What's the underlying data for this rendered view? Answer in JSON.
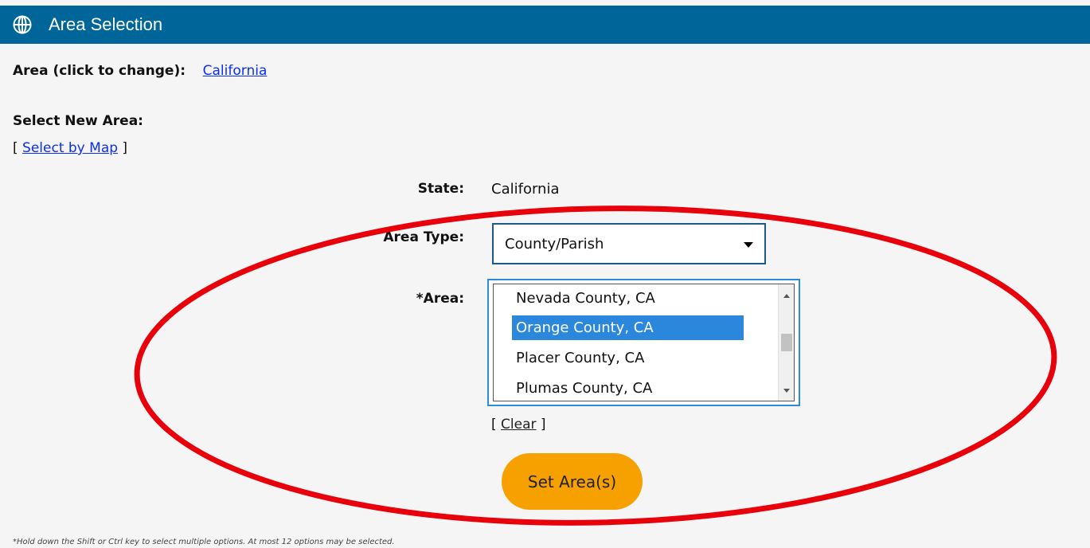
{
  "header": {
    "title": "Area Selection",
    "icon": "globe-icon"
  },
  "current_area": {
    "label": "Area (click to change):",
    "value": "California"
  },
  "select_new": {
    "heading": "Select New Area:",
    "bracket_open": "[ ",
    "map_link": "Select by Map",
    "bracket_close": " ]"
  },
  "form": {
    "state_label": "State:",
    "state_value": "California",
    "area_type_label": "Area Type:",
    "area_type_value": "County/Parish",
    "area_label": "*Area:",
    "area_options": [
      {
        "label": "Nevada County, CA",
        "selected": false
      },
      {
        "label": "Orange County, CA",
        "selected": true
      },
      {
        "label": "Placer County, CA",
        "selected": false
      },
      {
        "label": "Plumas County, CA",
        "selected": false
      }
    ],
    "clear_open": "[ ",
    "clear_link": "Clear",
    "clear_close": " ]",
    "submit_label": "Set Area(s)"
  },
  "footnote": "*Hold down the Shift or Ctrl key to select multiple options. At most 12 options may be selected.",
  "colors": {
    "header_bg": "#006699",
    "selected_option": "#2b87dc",
    "button": "#f7a100",
    "annotation": "#e8000b",
    "link": "#0b2ff0"
  }
}
